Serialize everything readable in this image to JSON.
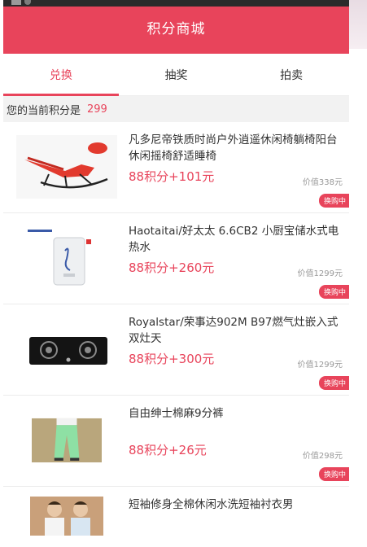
{
  "header": {
    "title": "积分商城"
  },
  "tabs": [
    {
      "label": "兑换",
      "active": true
    },
    {
      "label": "抽奖",
      "active": false
    },
    {
      "label": "拍卖",
      "active": false
    }
  ],
  "points": {
    "label": "您的当前积分是",
    "value": "299"
  },
  "items": [
    {
      "name": "凡多尼帝铁质时尚户外逍遥休闲椅躺椅阳台休闲摇椅舒适睡椅",
      "price": "88积分+101元",
      "worth": "价值338元",
      "badge": "换购中",
      "image": "red-rocking-chair"
    },
    {
      "name": "Haotaitai/好太太 6.6CB2 小厨宝储水式电热水",
      "price": "88积分+260元",
      "worth": "价值1299元",
      "badge": "换购中",
      "image": "water-heater"
    },
    {
      "name": "Royalstar/荣事达902M B97燃气灶嵌入式双灶天",
      "price": "88积分+300元",
      "worth": "价值1299元",
      "badge": "换购中",
      "image": "gas-stove"
    },
    {
      "name": "自由绅士棉麻9分裤",
      "price": "88积分+26元",
      "worth": "价值298元",
      "badge": "换购中",
      "image": "green-pants"
    },
    {
      "name": "短袖修身全棉休闲水洗短袖衬衣男",
      "image": "couple-shirts"
    }
  ],
  "colors": {
    "accent": "#e8445b",
    "header_bg": "#e8445b",
    "points_bg": "#f2f2f2"
  }
}
